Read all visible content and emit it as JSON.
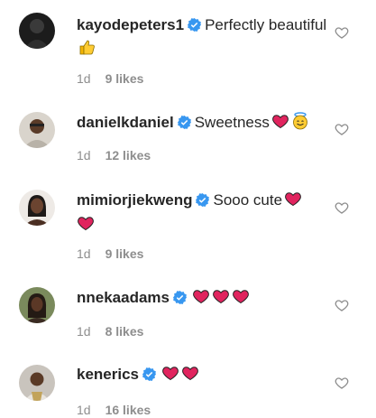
{
  "comments": [
    {
      "username": "kayodepeters1",
      "verified": true,
      "text": "Perfectly beautiful",
      "emojis": [
        "thumbs-up"
      ],
      "time": "1d",
      "likes": "9 likes"
    },
    {
      "username": "danielkdaniel",
      "verified": true,
      "text": "Sweetness",
      "emojis": [
        "red-heart",
        "smiling-face-with-halo"
      ],
      "time": "1d",
      "likes": "12 likes"
    },
    {
      "username": "mimiorjiekweng",
      "verified": true,
      "text": "Sooo cute",
      "emojis": [
        "red-heart",
        "red-heart"
      ],
      "time": "1d",
      "likes": "9 likes"
    },
    {
      "username": "nnekaadams",
      "verified": true,
      "text": "",
      "emojis": [
        "red-heart",
        "red-heart",
        "red-heart"
      ],
      "time": "1d",
      "likes": "8 likes"
    },
    {
      "username": "kenerics",
      "verified": true,
      "text": "",
      "emojis": [
        "red-heart",
        "red-heart"
      ],
      "time": "1d",
      "likes": "16 likes"
    }
  ],
  "icons": {
    "verified": "verified-badge-icon",
    "like": "heart-outline-icon"
  },
  "colors": {
    "verified_blue": "#3897f0",
    "meta_gray": "#8e8e8e",
    "heart_red": "#e0245e"
  }
}
